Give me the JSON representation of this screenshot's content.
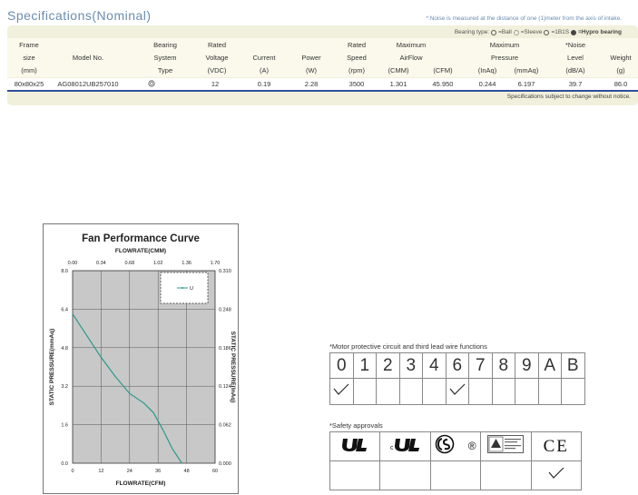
{
  "specifications": {
    "title": "Specifications(Nominal)",
    "noise_note": "*:Noise is measured at the distance of one (1)meter from the axis of intake.",
    "bearing_type": {
      "label": "Bearing type:",
      "ball": "=Ball",
      "sleeve": "=Sleeve",
      "one_b_one_s": "=1B1S",
      "hypro": "=Hypro bearing"
    },
    "headers": [
      {
        "lines": [
          "Frame",
          "size",
          "(mm)"
        ]
      },
      {
        "lines": [
          "",
          "Model No.",
          ""
        ]
      },
      {
        "lines": [
          "Bearing",
          "System",
          "Type"
        ]
      },
      {
        "lines": [
          "Rated",
          "Voltage",
          "(VDC)"
        ]
      },
      {
        "lines": [
          "",
          "Current",
          "(A)"
        ]
      },
      {
        "lines": [
          "",
          "Power",
          "(W)"
        ]
      },
      {
        "lines": [
          "Rated",
          "Speed",
          "(rpm)"
        ]
      },
      {
        "lines": [
          "Maximum",
          "AirFlow",
          ""
        ]
      },
      {
        "lines": [
          "",
          "",
          "(CMM)"
        ]
      },
      {
        "lines": [
          "",
          "",
          "(CFM)"
        ]
      },
      {
        "lines": [
          "Maximum",
          "Pressure",
          ""
        ]
      },
      {
        "lines": [
          "",
          "",
          "(InAq)"
        ]
      },
      {
        "lines": [
          "",
          "",
          "(mmAq)"
        ]
      },
      {
        "lines": [
          "*Noise",
          "Level",
          "(dB/A)"
        ]
      },
      {
        "lines": [
          "",
          "Weight",
          "(g)"
        ]
      }
    ],
    "row": {
      "frame_size": "80x80x25",
      "model_no": "AG08012UB257010",
      "bearing_icon": "ball-bearing-icon",
      "rated_voltage": "12",
      "current": "0.19",
      "power": "2.28",
      "rated_speed": "3500",
      "airflow_cmm": "1.301",
      "airflow_cfm": "45.950",
      "pressure_inaq": "0.244",
      "pressure_mmaq": "6.197",
      "noise": "39.7",
      "weight": "86.0"
    },
    "footnote": "Specifications subject to change without notice."
  },
  "chart_data": {
    "type": "line",
    "title": "Fan Performance Curve",
    "xlabel": "FLOWRATE(CFM)",
    "x2label": "FLOWRATE(CMM)",
    "ylabel": "STATIC PRESSURE(mmAq)",
    "y2label": "STATIC PRESSURE(InAq)",
    "xlim": [
      0,
      60
    ],
    "ylim": [
      0,
      8
    ],
    "x_ticks": [
      "0",
      "12",
      "24",
      "36",
      "48",
      "60"
    ],
    "x2_ticks": [
      "0.00",
      "0.34",
      "0.68",
      "1.02",
      "1.36",
      "1.70"
    ],
    "y_ticks": [
      "0.0",
      "1.6",
      "3.2",
      "4.8",
      "6.4",
      "8.0"
    ],
    "y2_ticks": [
      "0.000",
      "0.062",
      "0.124",
      "0.186",
      "0.248",
      "0.310"
    ],
    "grid": true,
    "legend_placement": "top-right",
    "background": "#c8c8c8",
    "series": [
      {
        "name": "U",
        "color": "#2a9a8a",
        "x": [
          0,
          6,
          12,
          18,
          24,
          30,
          34,
          38,
          42,
          46
        ],
        "y": [
          6.2,
          5.3,
          4.4,
          3.6,
          2.9,
          2.5,
          2.1,
          1.4,
          0.6,
          0
        ]
      }
    ]
  },
  "functions": {
    "caption": "*Motor protective circuit and third lead wire functions",
    "digits": [
      "0",
      "1",
      "2",
      "3",
      "4",
      "6",
      "7",
      "8",
      "9",
      "A",
      "B"
    ],
    "checked": [
      true,
      false,
      false,
      false,
      false,
      true,
      false,
      false,
      false,
      false,
      false
    ]
  },
  "safety": {
    "caption": "*Safety approvals",
    "logos": [
      "ul-logo-icon",
      "cul-logo-icon",
      "csa-logo-icon",
      "tuv-logo-icon",
      "ce-logo-icon"
    ],
    "csa_mark": "®",
    "ce_text": "CE",
    "checked": [
      false,
      false,
      false,
      false,
      true
    ]
  }
}
